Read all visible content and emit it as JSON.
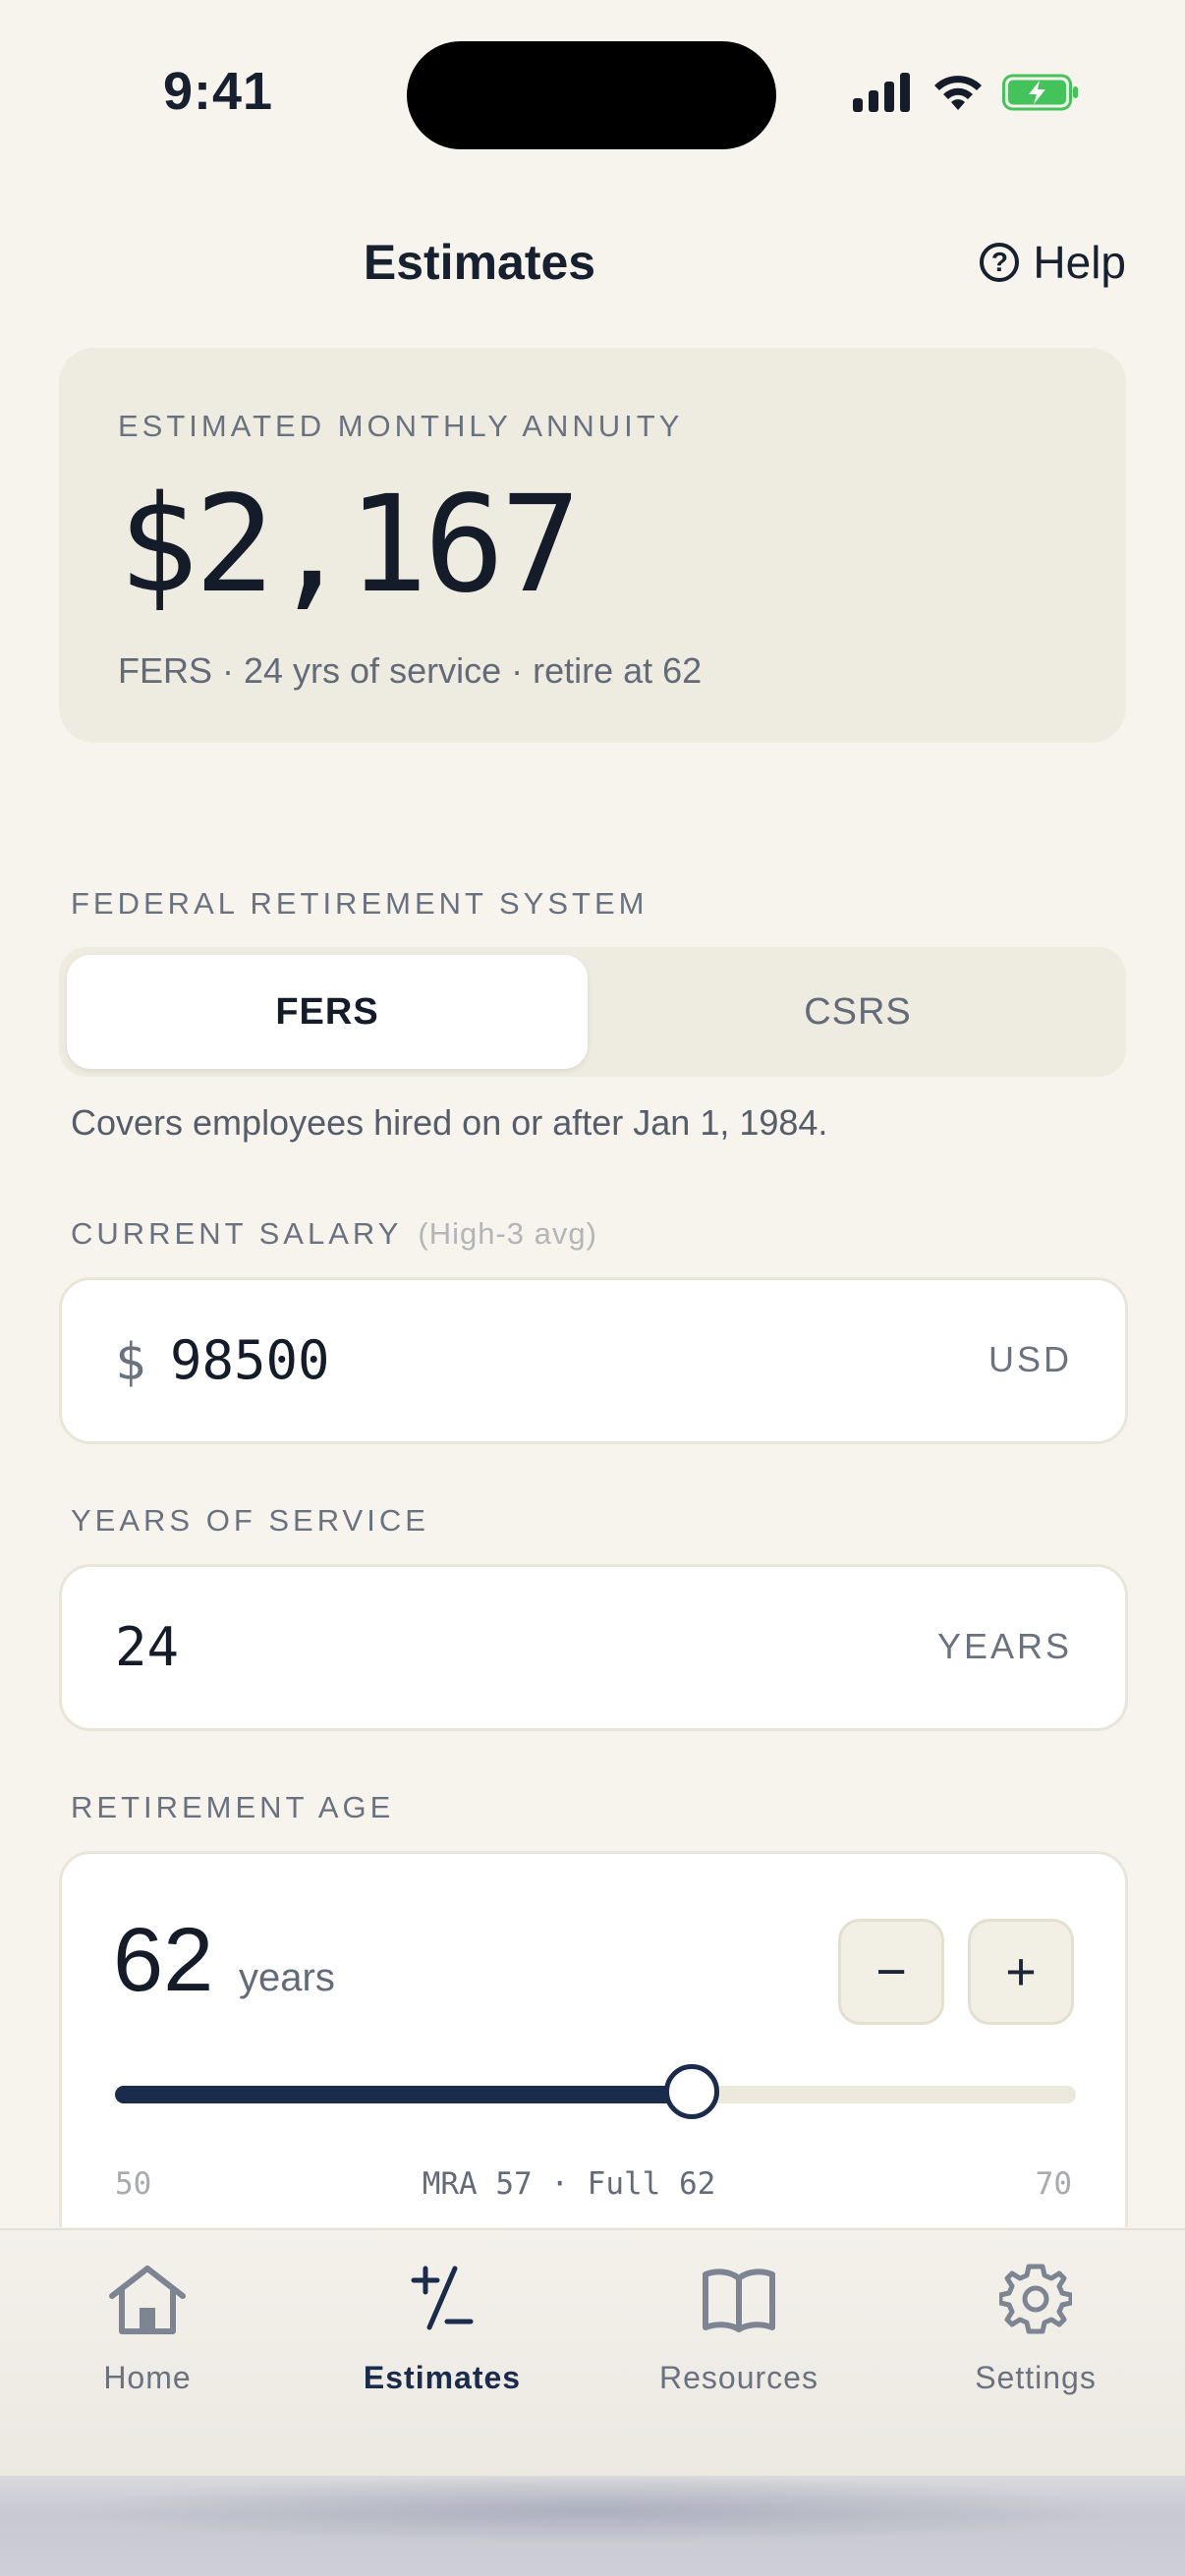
{
  "status": {
    "time": "9:41"
  },
  "header": {
    "title": "Estimates",
    "help_label": "Help",
    "help_icon": "?"
  },
  "summary": {
    "label": "ESTIMATED MONTHLY ANNUITY",
    "amount": "$2,167",
    "details": "FERS · 24 yrs of service · retire at 62"
  },
  "retirement_system": {
    "label": "FEDERAL RETIREMENT SYSTEM",
    "options": [
      "FERS",
      "CSRS"
    ],
    "selected": "FERS",
    "description": "Covers employees hired on or after Jan 1, 1984."
  },
  "salary": {
    "label": "CURRENT SALARY",
    "hint": "(High-3 avg)",
    "prefix": "$",
    "value": "98500",
    "unit": "USD"
  },
  "service": {
    "label": "YEARS OF SERVICE",
    "value": "24",
    "unit": "YEARS"
  },
  "retirement_age": {
    "label": "RETIREMENT AGE",
    "value": "62",
    "unit": "years",
    "decrement": "−",
    "increment": "+",
    "min": "50",
    "max": "70",
    "slider_value": 62,
    "marker_text": "MRA 57 · Full 62"
  },
  "tabs": [
    {
      "label": "Home",
      "icon": "home-icon"
    },
    {
      "label": "Estimates",
      "icon": "plus-minus-icon",
      "active": true
    },
    {
      "label": "Resources",
      "icon": "book-icon"
    },
    {
      "label": "Settings",
      "icon": "gear-icon"
    }
  ],
  "colors": {
    "accent": "#1a2b4c",
    "background": "#f6f4ed",
    "card": "#eeebe0"
  }
}
